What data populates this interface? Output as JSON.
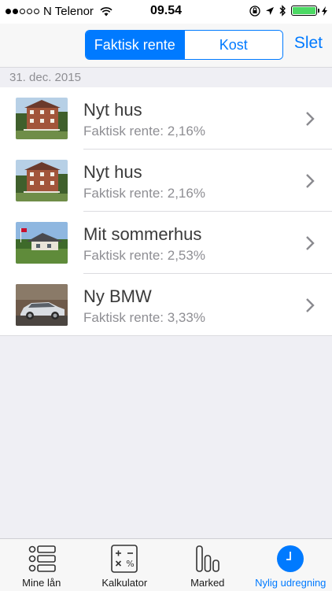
{
  "statusbar": {
    "carrier": "N Telenor",
    "time": "09.54",
    "signal_bars_filled": 2,
    "signal_bars_total": 5,
    "battery_level": 1.0
  },
  "navbar": {
    "segments": [
      {
        "label": "Faktisk rente",
        "active": true
      },
      {
        "label": "Kost",
        "active": false
      }
    ],
    "delete_label": "Slet"
  },
  "section": {
    "date": "31. dec. 2015"
  },
  "loans": [
    {
      "title": "Nyt hus",
      "subtitle": "Faktisk rente: 2,16%",
      "image": "house-photo"
    },
    {
      "title": "Nyt hus",
      "subtitle": "Faktisk rente: 2,16%",
      "image": "house-photo"
    },
    {
      "title": "Mit sommerhus",
      "subtitle": "Faktisk rente: 2,53%",
      "image": "summerhouse-photo"
    },
    {
      "title": "Ny BMW",
      "subtitle": "Faktisk rente: 3,33%",
      "image": "car-photo"
    }
  ],
  "tabbar": {
    "tabs": [
      {
        "label": "Mine lån",
        "icon": "list-icon",
        "active": false
      },
      {
        "label": "Kalkulator",
        "icon": "calculator-icon",
        "active": false
      },
      {
        "label": "Marked",
        "icon": "bar-chart-icon",
        "active": false
      },
      {
        "label": "Nylig udregning",
        "icon": "clock-icon",
        "active": true
      }
    ]
  },
  "colors": {
    "accent": "#007aff",
    "background": "#efeff4",
    "battery": "#4cd964"
  }
}
